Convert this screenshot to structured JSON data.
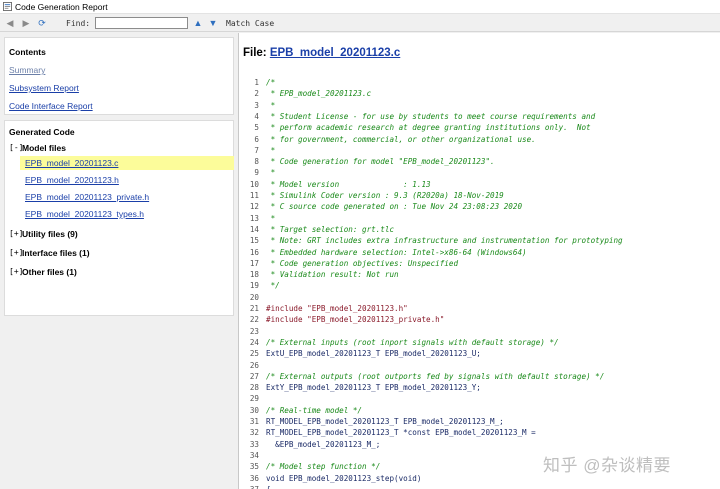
{
  "window": {
    "title": "Code Generation Report"
  },
  "toolbar": {
    "find_label": "Find:",
    "find_value": "",
    "match_case_label": "Match Case"
  },
  "contents": {
    "title": "Contents",
    "links": [
      "Summary",
      "Subsystem Report",
      "Code Interface Report"
    ]
  },
  "generated": {
    "title": "Generated Code",
    "model_files": {
      "toggle": "[-]",
      "label": "Model files",
      "files": [
        "EPB_model_20201123.c",
        "EPB_model_20201123.h",
        "EPB_model_20201123_private.h",
        "EPB_model_20201123_types.h"
      ],
      "selected": "EPB_model_20201123.c"
    },
    "groups": [
      {
        "toggle": "[+]",
        "label": "Utility files (9)"
      },
      {
        "toggle": "[+]",
        "label": "Interface files (1)"
      },
      {
        "toggle": "[+]",
        "label": "Other files (1)"
      }
    ]
  },
  "code_view": {
    "file_prefix": "File: ",
    "file_name": "EPB_model_20201123.c",
    "lines": [
      {
        "n": "1",
        "type": "comment",
        "text": "/*"
      },
      {
        "n": "2",
        "type": "comment",
        "text": " * EPB_model_20201123.c"
      },
      {
        "n": "3",
        "type": "comment",
        "text": " *"
      },
      {
        "n": "4",
        "type": "comment",
        "text": " * Student License - for use by students to meet course requirements and"
      },
      {
        "n": "5",
        "type": "comment",
        "text": " * perform academic research at degree granting institutions only.  Not"
      },
      {
        "n": "6",
        "type": "comment",
        "text": " * for government, commercial, or other organizational use."
      },
      {
        "n": "7",
        "type": "comment",
        "text": " *"
      },
      {
        "n": "8",
        "type": "comment",
        "text": " * Code generation for model \"EPB_model_20201123\"."
      },
      {
        "n": "9",
        "type": "comment",
        "text": " *"
      },
      {
        "n": "10",
        "type": "comment",
        "text": " * Model version              : 1.13"
      },
      {
        "n": "11",
        "type": "comment",
        "text": " * Simulink Coder version : 9.3 (R2020a) 18-Nov-2019"
      },
      {
        "n": "12",
        "type": "comment",
        "text": " * C source code generated on : Tue Nov 24 23:08:23 2020"
      },
      {
        "n": "13",
        "type": "comment",
        "text": " *"
      },
      {
        "n": "14",
        "type": "comment",
        "text": " * Target selection: grt.tlc"
      },
      {
        "n": "15",
        "type": "comment",
        "text": " * Note: GRT includes extra infrastructure and instrumentation for prototyping"
      },
      {
        "n": "16",
        "type": "comment",
        "text": " * Embedded hardware selection: Intel->x86-64 (Windows64)"
      },
      {
        "n": "17",
        "type": "comment",
        "text": " * Code generation objectives: Unspecified"
      },
      {
        "n": "18",
        "type": "comment",
        "text": " * Validation result: Not run"
      },
      {
        "n": "19",
        "type": "comment",
        "text": " */"
      },
      {
        "n": "20",
        "type": "code",
        "text": ""
      },
      {
        "n": "21",
        "type": "pre",
        "text": "#include \"EPB_model_20201123.h\""
      },
      {
        "n": "22",
        "type": "pre",
        "text": "#include \"EPB_model_20201123_private.h\""
      },
      {
        "n": "23",
        "type": "code",
        "text": ""
      },
      {
        "n": "24",
        "type": "comment",
        "text": "/* External inputs (root inport signals with default storage) */"
      },
      {
        "n": "25",
        "type": "code",
        "text": "ExtU_EPB_model_20201123_T EPB_model_20201123_U;"
      },
      {
        "n": "26",
        "type": "code",
        "text": ""
      },
      {
        "n": "27",
        "type": "comment",
        "text": "/* External outputs (root outports fed by signals with default storage) */"
      },
      {
        "n": "28",
        "type": "code",
        "text": "ExtY_EPB_model_20201123_T EPB_model_20201123_Y;"
      },
      {
        "n": "29",
        "type": "code",
        "text": ""
      },
      {
        "n": "30",
        "type": "comment",
        "text": "/* Real-time model */"
      },
      {
        "n": "31",
        "type": "code",
        "text": "RT_MODEL_EPB_model_20201123_T EPB_model_20201123_M_;"
      },
      {
        "n": "32",
        "type": "code",
        "text": "RT_MODEL_EPB_model_20201123_T *const EPB_model_20201123_M ="
      },
      {
        "n": "33",
        "type": "code",
        "text": "  &EPB_model_20201123_M_;"
      },
      {
        "n": "34",
        "type": "code",
        "text": ""
      },
      {
        "n": "35",
        "type": "comment",
        "text": "/* Model step function */"
      },
      {
        "n": "36",
        "type": "code",
        "text": "void EPB_model_20201123_step(void)"
      },
      {
        "n": "37",
        "type": "code",
        "text": "{"
      }
    ]
  },
  "watermark": {
    "text": "知乎 @杂谈精要"
  },
  "colors": {
    "link": "#1a3fa8",
    "comment": "#1a8a1a",
    "preprocessor": "#8a1a2a",
    "selected_file_bg": "#fcfc9a"
  }
}
